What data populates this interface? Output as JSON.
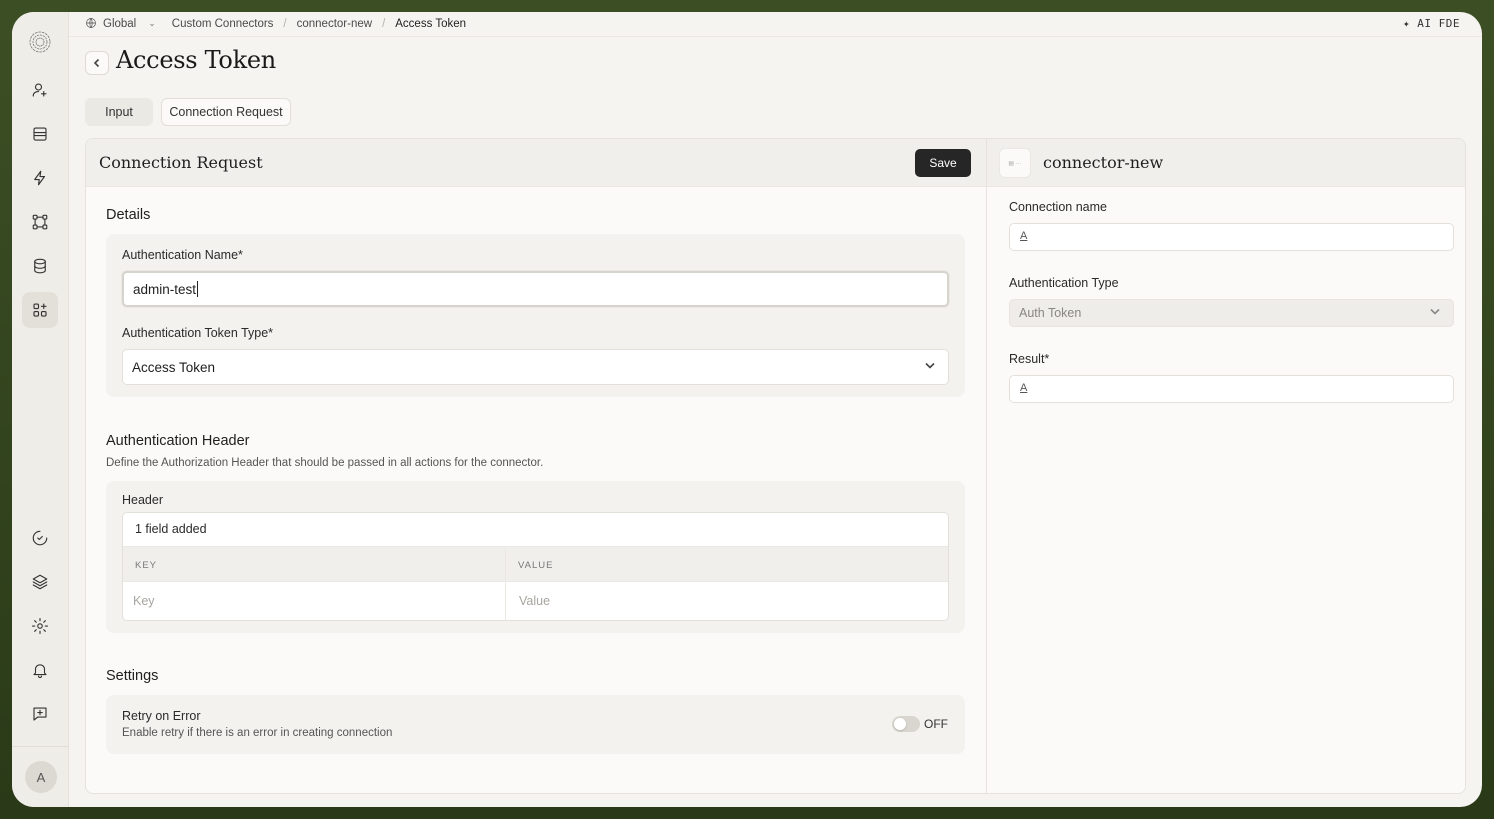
{
  "breadcrumb": {
    "scope": "Global",
    "items": [
      "Custom Connectors",
      "connector-new",
      "Access Token"
    ]
  },
  "topbar": {
    "ai_label": "✦ AI FDE"
  },
  "page": {
    "title": "Access Token"
  },
  "tabs": [
    {
      "label": "Input",
      "active": false
    },
    {
      "label": "Connection Request",
      "active": true
    }
  ],
  "form": {
    "title": "Connection Request",
    "save_label": "Save",
    "details": {
      "heading": "Details",
      "auth_name_label": "Authentication Name*",
      "auth_name_value": "admin-test",
      "token_type_label": "Authentication Token Type*",
      "token_type_value": "Access Token"
    },
    "auth_header": {
      "heading": "Authentication Header",
      "description": "Define the Authorization Header that should be passed in all actions for the connector.",
      "header_label": "Header",
      "count_text": "1 field added",
      "col_key": "KEY",
      "col_value": "VALUE",
      "key_placeholder": "Key",
      "value_placeholder": "Value"
    },
    "settings": {
      "heading": "Settings",
      "retry_title": "Retry on Error",
      "retry_desc": "Enable retry if there is an error in creating connection",
      "retry_state": "OFF"
    }
  },
  "connector_panel": {
    "name": "connector-new",
    "connection_name_label": "Connection name",
    "auth_type_label": "Authentication Type",
    "auth_type_value": "Auth Token",
    "result_label": "Result*"
  },
  "user": {
    "avatar_initial": "A"
  },
  "colors": {
    "primary_button": "#262626",
    "background": "#f6f4f0"
  }
}
